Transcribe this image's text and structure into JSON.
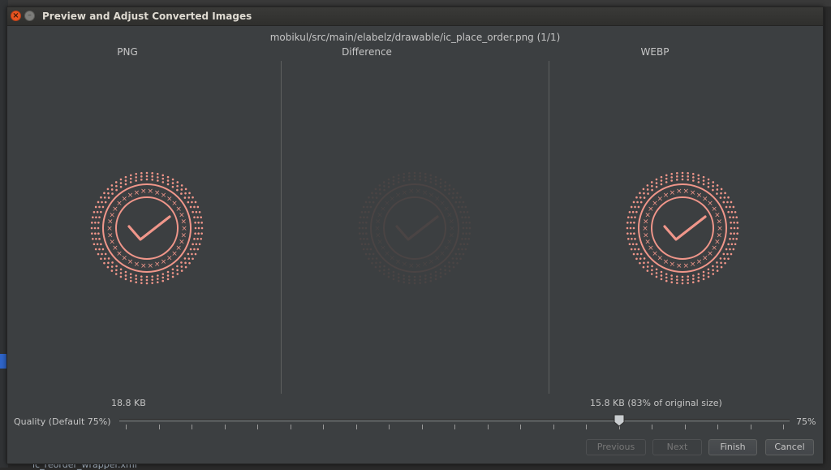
{
  "dialog": {
    "title": "Preview and Adjust Converted Images",
    "file_path": "mobikul/src/main/elabelz/drawable/ic_place_order.png (1/1)"
  },
  "columns": {
    "png_label": "PNG",
    "difference_label": "Difference",
    "webp_label": "WEBP"
  },
  "sizes": {
    "png_size": "18.8 KB",
    "webp_size": "15.8 KB (83% of original size)"
  },
  "quality": {
    "label": "Quality (Default 75%)",
    "value_text": "75%",
    "value": 75,
    "min": 0,
    "max": 100
  },
  "buttons": {
    "previous": "Previous",
    "next": "Next",
    "finish": "Finish",
    "cancel": "Cancel"
  },
  "background": {
    "bottom_file": "ic_reorder_wrapper.xml"
  },
  "icon": {
    "name": "place-order-check-badge-icon",
    "color": "#f0968a",
    "diff_color": "#4a4444"
  }
}
